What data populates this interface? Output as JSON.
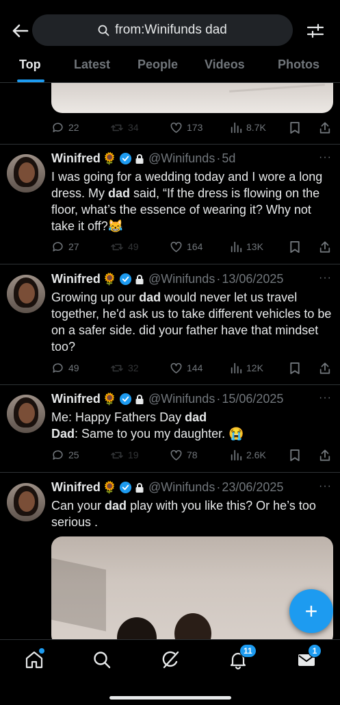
{
  "header": {
    "search_query": "from:Winifunds dad"
  },
  "tabs": [
    {
      "label": "Top",
      "active": true
    },
    {
      "label": "Latest",
      "active": false
    },
    {
      "label": "People",
      "active": false
    },
    {
      "label": "Videos",
      "active": false
    },
    {
      "label": "Photos",
      "active": false
    }
  ],
  "prev_tweet_stats": {
    "replies": "22",
    "reposts": "34",
    "likes": "173",
    "views": "8.7K"
  },
  "tweets": [
    {
      "name": "Winifred",
      "emoji": "🌻",
      "handle": "@Winifunds",
      "time": "5d",
      "text_html": "I was going for a wedding today and I wore a long dress. My <b>dad</b> said, “If the dress is flowing on the floor, what’s the essence of wearing it? Why not take it off?😹",
      "replies": "27",
      "reposts": "49",
      "likes": "164",
      "views": "13K"
    },
    {
      "name": "Winifred",
      "emoji": "🌻",
      "handle": "@Winifunds",
      "time": "13/06/2025",
      "text_html": "Growing up our <b>dad</b> would never let us travel together, he'd ask us to take different vehicles to be on a safer side. did your father have that mindset too?",
      "replies": "49",
      "reposts": "32",
      "likes": "144",
      "views": "12K"
    },
    {
      "name": "Winifred",
      "emoji": "🌻",
      "handle": "@Winifunds",
      "time": "15/06/2025",
      "text_html": "Me: Happy Fathers Day <b>dad</b><br><b>Dad</b>: Same to you my daughter. 😭",
      "replies": "25",
      "reposts": "19",
      "likes": "78",
      "views": "2.6K"
    },
    {
      "name": "Winifred",
      "emoji": "🌻",
      "handle": "@Winifunds",
      "time": "23/06/2025",
      "text_html": "Can your <b>dad</b> play with you like this? Or he’s too serious .",
      "replies": "",
      "reposts": "",
      "likes": "",
      "views": ""
    }
  ],
  "bottom_nav": {
    "notifications_count": "11",
    "messages_count": "1"
  },
  "colors": {
    "accent": "#1d9bf0",
    "background": "#000000",
    "muted": "#71767b",
    "text": "#e7e9ea"
  },
  "icons": [
    "back-arrow-icon",
    "search-icon",
    "filter-icon",
    "reply-icon",
    "repost-icon",
    "like-icon",
    "views-icon",
    "bookmark-icon",
    "share-icon",
    "verified-badge-icon",
    "lock-icon",
    "more-icon",
    "home-icon",
    "explore-icon",
    "grok-icon",
    "notifications-icon",
    "messages-icon",
    "compose-icon"
  ]
}
